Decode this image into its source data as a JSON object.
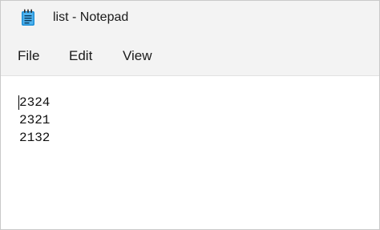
{
  "window": {
    "title": "list - Notepad",
    "icon": "notepad-icon"
  },
  "menu": {
    "file": "File",
    "edit": "Edit",
    "view": "View"
  },
  "editor": {
    "lines": [
      "2324",
      "2321",
      "2132"
    ]
  },
  "colors": {
    "titlebar_bg": "#f3f3f3",
    "editor_bg": "#ffffff",
    "icon_blue": "#1e8fd6"
  }
}
